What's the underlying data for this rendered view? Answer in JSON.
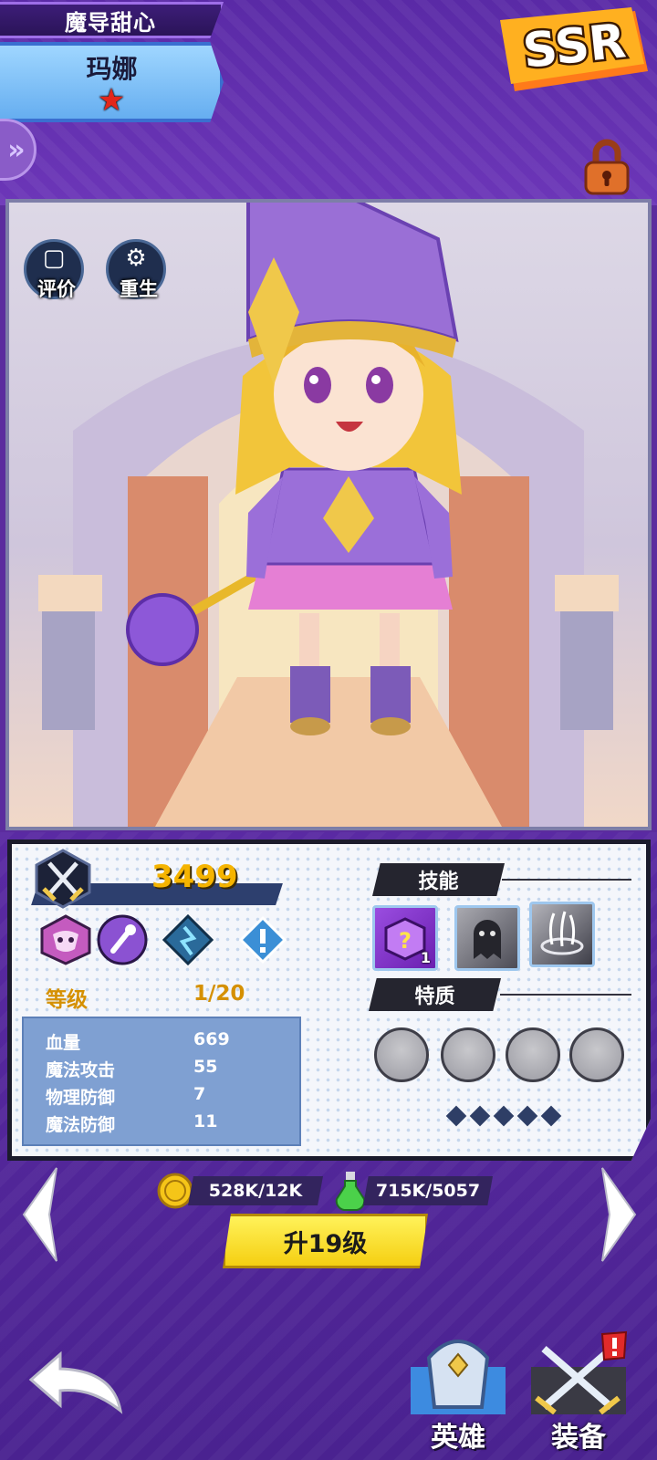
{
  "hero": {
    "title": "魔导甜心",
    "name": "玛娜",
    "rarity": "SSR",
    "stars": 1
  },
  "header": {
    "side_tab_glyph": "»"
  },
  "scene": {
    "buttons": [
      {
        "label": "评价",
        "icon": "comment-icon"
      },
      {
        "label": "重生",
        "icon": "gear-icon"
      }
    ]
  },
  "stats": {
    "power": "3499",
    "level_label": "等级",
    "level_value": "1/20",
    "rows": [
      {
        "label": "血量",
        "value": "669"
      },
      {
        "label": "魔法攻击",
        "value": "55"
      },
      {
        "label": "物理防御",
        "value": "7"
      },
      {
        "label": "魔法防御",
        "value": "11"
      }
    ],
    "trait_icons": [
      "mask-icon",
      "staff-icon",
      "rune-icon",
      "info-icon"
    ]
  },
  "skills": {
    "header": "技能",
    "items": [
      {
        "icon": "mystery-box-icon",
        "count": "1"
      },
      {
        "icon": "ghost-icon",
        "count": ""
      },
      {
        "icon": "vortex-icon",
        "count": ""
      }
    ]
  },
  "traits": {
    "header": "特质",
    "slots": 4,
    "diamonds": 5
  },
  "costs": {
    "gold": "528K/12K",
    "potion": "715K/5057"
  },
  "upgrade": {
    "label": "升19级"
  },
  "tabs": {
    "hero": "英雄",
    "equipment": "装备"
  },
  "colors": {
    "background": "#5b2c9e",
    "accent_gold": "#f5b400",
    "button_yellow": "#f5cf12",
    "stats_panel": "#7fa0d2"
  }
}
